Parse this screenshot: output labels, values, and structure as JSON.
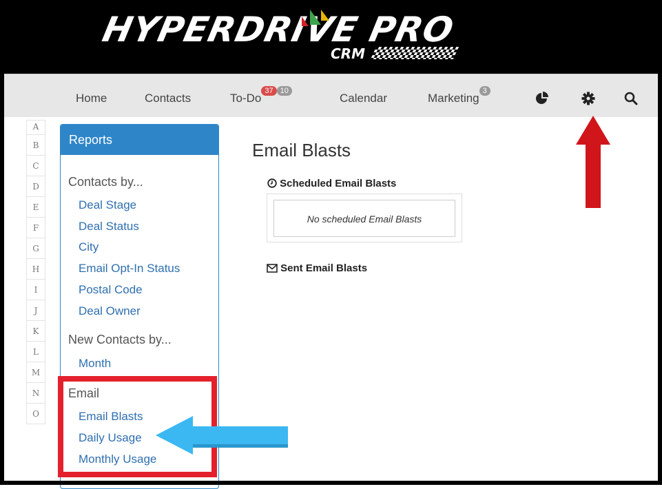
{
  "logo": {
    "main": "HYPERDRIVE PRO",
    "sub": "CRM"
  },
  "nav": {
    "home": "Home",
    "contacts": "Contacts",
    "todo": "To-Do",
    "todo_badge_red": "37",
    "todo_badge_gray": "10",
    "calendar": "Calendar",
    "marketing": "Marketing",
    "marketing_badge": "3",
    "icons": [
      "pie-chart-icon",
      "gear-icon",
      "search-icon"
    ]
  },
  "alphabet": [
    "A",
    "B",
    "C",
    "D",
    "E",
    "F",
    "G",
    "H",
    "I",
    "J",
    "K",
    "L",
    "M",
    "N",
    "O"
  ],
  "reports": {
    "title": "Reports",
    "contacts_by": "Contacts by...",
    "contacts_links": [
      "Deal Stage",
      "Deal Status",
      "City",
      "Email Opt-In Status",
      "Postal Code",
      "Deal Owner"
    ],
    "new_contacts_by": "New Contacts by...",
    "new_contacts_links": [
      "Month"
    ],
    "email": "Email",
    "email_links": [
      "Email Blasts",
      "Daily Usage",
      "Monthly Usage"
    ]
  },
  "main": {
    "title": "Email Blasts",
    "scheduled_title": "Scheduled Email Blasts",
    "scheduled_empty": "No scheduled Email Blasts",
    "sent_title": "Sent Email Blasts"
  },
  "colors": {
    "accent": "#2e86c9",
    "highlight": "#e3202b",
    "red_arrow": "#d0161b",
    "blue_arrow": "#3bb8f2"
  }
}
